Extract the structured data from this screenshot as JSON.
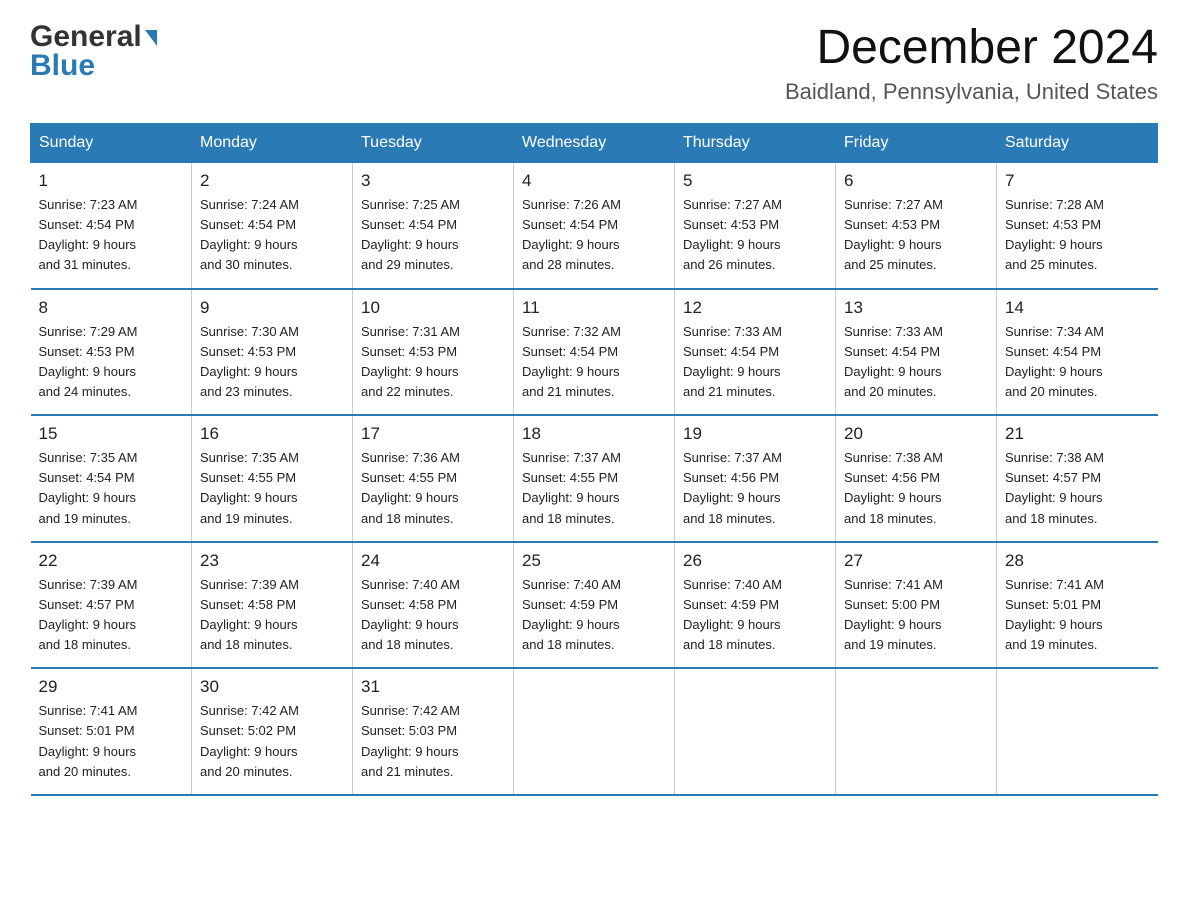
{
  "logo": {
    "part1": "General",
    "part2": "Blue"
  },
  "title": "December 2024",
  "location": "Baidland, Pennsylvania, United States",
  "days_of_week": [
    "Sunday",
    "Monday",
    "Tuesday",
    "Wednesday",
    "Thursday",
    "Friday",
    "Saturday"
  ],
  "weeks": [
    [
      {
        "day": "1",
        "sunrise": "7:23 AM",
        "sunset": "4:54 PM",
        "daylight": "9 hours and 31 minutes."
      },
      {
        "day": "2",
        "sunrise": "7:24 AM",
        "sunset": "4:54 PM",
        "daylight": "9 hours and 30 minutes."
      },
      {
        "day": "3",
        "sunrise": "7:25 AM",
        "sunset": "4:54 PM",
        "daylight": "9 hours and 29 minutes."
      },
      {
        "day": "4",
        "sunrise": "7:26 AM",
        "sunset": "4:54 PM",
        "daylight": "9 hours and 28 minutes."
      },
      {
        "day": "5",
        "sunrise": "7:27 AM",
        "sunset": "4:53 PM",
        "daylight": "9 hours and 26 minutes."
      },
      {
        "day": "6",
        "sunrise": "7:27 AM",
        "sunset": "4:53 PM",
        "daylight": "9 hours and 25 minutes."
      },
      {
        "day": "7",
        "sunrise": "7:28 AM",
        "sunset": "4:53 PM",
        "daylight": "9 hours and 25 minutes."
      }
    ],
    [
      {
        "day": "8",
        "sunrise": "7:29 AM",
        "sunset": "4:53 PM",
        "daylight": "9 hours and 24 minutes."
      },
      {
        "day": "9",
        "sunrise": "7:30 AM",
        "sunset": "4:53 PM",
        "daylight": "9 hours and 23 minutes."
      },
      {
        "day": "10",
        "sunrise": "7:31 AM",
        "sunset": "4:53 PM",
        "daylight": "9 hours and 22 minutes."
      },
      {
        "day": "11",
        "sunrise": "7:32 AM",
        "sunset": "4:54 PM",
        "daylight": "9 hours and 21 minutes."
      },
      {
        "day": "12",
        "sunrise": "7:33 AM",
        "sunset": "4:54 PM",
        "daylight": "9 hours and 21 minutes."
      },
      {
        "day": "13",
        "sunrise": "7:33 AM",
        "sunset": "4:54 PM",
        "daylight": "9 hours and 20 minutes."
      },
      {
        "day": "14",
        "sunrise": "7:34 AM",
        "sunset": "4:54 PM",
        "daylight": "9 hours and 20 minutes."
      }
    ],
    [
      {
        "day": "15",
        "sunrise": "7:35 AM",
        "sunset": "4:54 PM",
        "daylight": "9 hours and 19 minutes."
      },
      {
        "day": "16",
        "sunrise": "7:35 AM",
        "sunset": "4:55 PM",
        "daylight": "9 hours and 19 minutes."
      },
      {
        "day": "17",
        "sunrise": "7:36 AM",
        "sunset": "4:55 PM",
        "daylight": "9 hours and 18 minutes."
      },
      {
        "day": "18",
        "sunrise": "7:37 AM",
        "sunset": "4:55 PM",
        "daylight": "9 hours and 18 minutes."
      },
      {
        "day": "19",
        "sunrise": "7:37 AM",
        "sunset": "4:56 PM",
        "daylight": "9 hours and 18 minutes."
      },
      {
        "day": "20",
        "sunrise": "7:38 AM",
        "sunset": "4:56 PM",
        "daylight": "9 hours and 18 minutes."
      },
      {
        "day": "21",
        "sunrise": "7:38 AM",
        "sunset": "4:57 PM",
        "daylight": "9 hours and 18 minutes."
      }
    ],
    [
      {
        "day": "22",
        "sunrise": "7:39 AM",
        "sunset": "4:57 PM",
        "daylight": "9 hours and 18 minutes."
      },
      {
        "day": "23",
        "sunrise": "7:39 AM",
        "sunset": "4:58 PM",
        "daylight": "9 hours and 18 minutes."
      },
      {
        "day": "24",
        "sunrise": "7:40 AM",
        "sunset": "4:58 PM",
        "daylight": "9 hours and 18 minutes."
      },
      {
        "day": "25",
        "sunrise": "7:40 AM",
        "sunset": "4:59 PM",
        "daylight": "9 hours and 18 minutes."
      },
      {
        "day": "26",
        "sunrise": "7:40 AM",
        "sunset": "4:59 PM",
        "daylight": "9 hours and 18 minutes."
      },
      {
        "day": "27",
        "sunrise": "7:41 AM",
        "sunset": "5:00 PM",
        "daylight": "9 hours and 19 minutes."
      },
      {
        "day": "28",
        "sunrise": "7:41 AM",
        "sunset": "5:01 PM",
        "daylight": "9 hours and 19 minutes."
      }
    ],
    [
      {
        "day": "29",
        "sunrise": "7:41 AM",
        "sunset": "5:01 PM",
        "daylight": "9 hours and 20 minutes."
      },
      {
        "day": "30",
        "sunrise": "7:42 AM",
        "sunset": "5:02 PM",
        "daylight": "9 hours and 20 minutes."
      },
      {
        "day": "31",
        "sunrise": "7:42 AM",
        "sunset": "5:03 PM",
        "daylight": "9 hours and 21 minutes."
      },
      null,
      null,
      null,
      null
    ]
  ],
  "labels": {
    "sunrise_prefix": "Sunrise: ",
    "sunset_prefix": "Sunset: ",
    "daylight_prefix": "Daylight: "
  }
}
